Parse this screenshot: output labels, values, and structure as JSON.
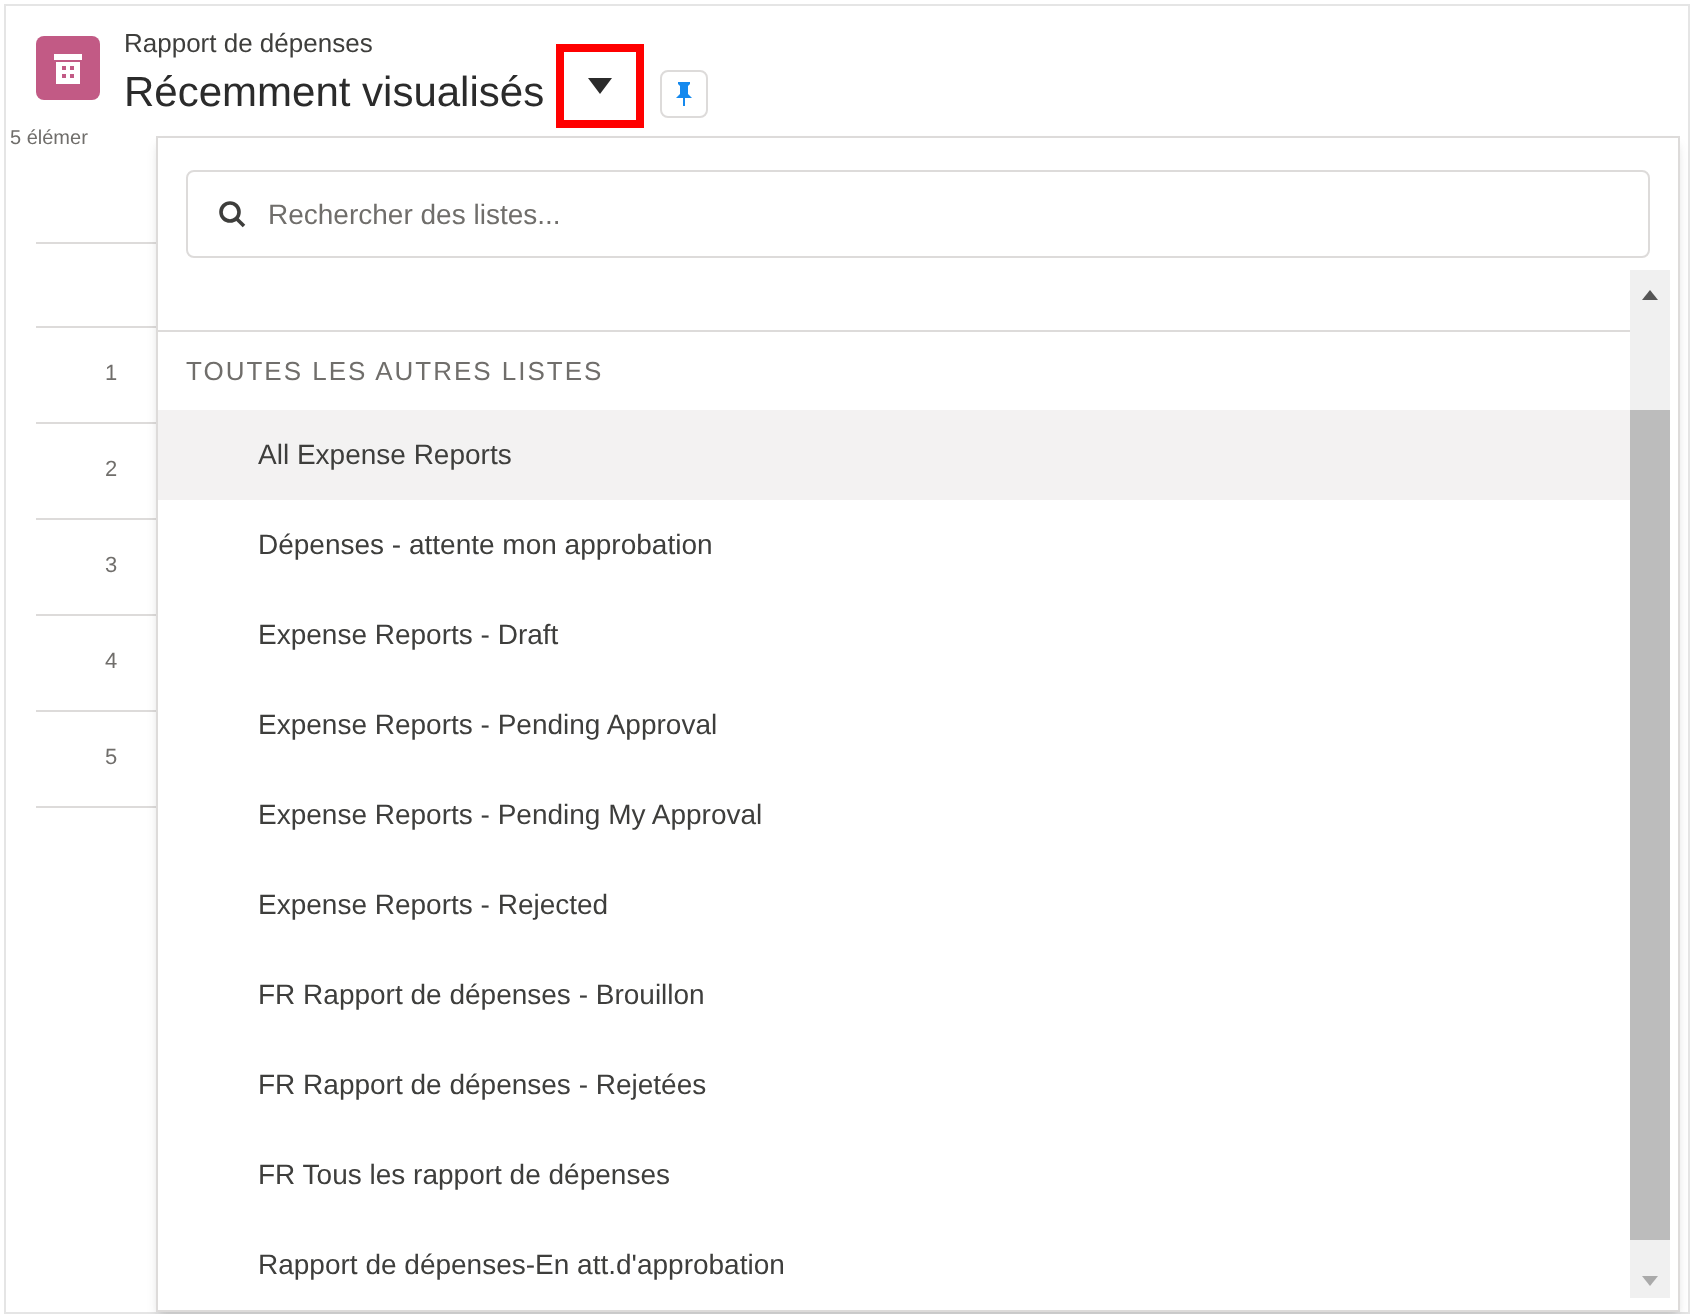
{
  "header": {
    "object_label": "Rapport de dépenses",
    "list_title": "Récemment visualisés",
    "item_count": "5 élémer"
  },
  "table": {
    "row_numbers": [
      "1",
      "2",
      "3",
      "4",
      "5"
    ]
  },
  "dropdown": {
    "search": {
      "placeholder": "Rechercher des listes..."
    },
    "section_title": "TOUTES LES AUTRES LISTES",
    "items": [
      {
        "label": "All Expense Reports",
        "selected": true
      },
      {
        "label": "Dépenses - attente mon approbation",
        "selected": false
      },
      {
        "label": "Expense Reports - Draft",
        "selected": false
      },
      {
        "label": "Expense Reports - Pending Approval",
        "selected": false
      },
      {
        "label": "Expense Reports - Pending My Approval",
        "selected": false
      },
      {
        "label": "Expense Reports - Rejected",
        "selected": false
      },
      {
        "label": "FR Rapport de dépenses - Brouillon",
        "selected": false
      },
      {
        "label": "FR Rapport de dépenses - Rejetées",
        "selected": false
      },
      {
        "label": "FR Tous les rapport de dépenses",
        "selected": false
      },
      {
        "label": "Rapport de dépenses-En att.d'approbation",
        "selected": false
      }
    ]
  }
}
